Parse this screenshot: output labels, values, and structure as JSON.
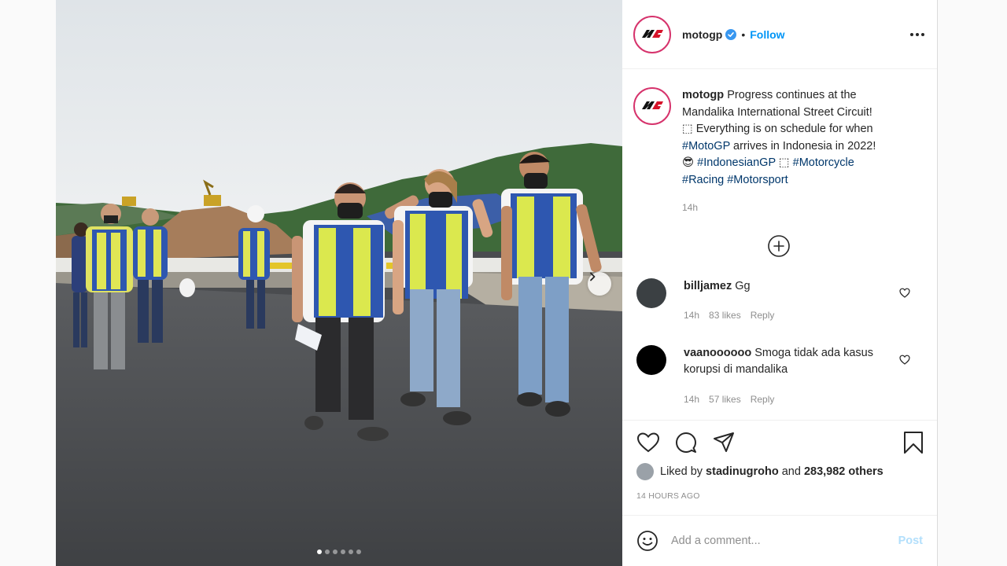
{
  "post": {
    "username": "motogp",
    "follow_label": "Follow",
    "separator": "•",
    "caption_lines": [
      [
        {
          "t": "Progress continues at the",
          "tag": false
        }
      ],
      [
        {
          "t": "Mandalika International Street Circuit!",
          "tag": false
        }
      ],
      [
        {
          "t": "⬚ Everything is on schedule for when",
          "tag": false
        }
      ],
      [
        {
          "t": "#MotoGP",
          "tag": true
        },
        {
          "t": " arrives in Indonesia in 2022!",
          "tag": false
        }
      ],
      [
        {
          "t": "😎 ",
          "tag": false
        },
        {
          "t": "#IndonesianGP",
          "tag": true
        },
        {
          "t": " ⬚ ",
          "tag": false
        },
        {
          "t": "#Motorcycle",
          "tag": true
        }
      ],
      [
        {
          "t": "#Racing",
          "tag": true
        },
        {
          "t": " ",
          "tag": false
        },
        {
          "t": "#Motorsport",
          "tag": true
        }
      ]
    ],
    "caption_time": "14h",
    "photo_count": 6,
    "active_photo": 0
  },
  "comments": [
    {
      "user": "billjamez",
      "text": "Gg",
      "time": "14h",
      "likes": "83 likes",
      "reply": "Reply",
      "avatar_color": "#3b4043"
    },
    {
      "user": "vaanoooooo",
      "text": "Smoga tidak ada kasus korupsi di mandalika",
      "time": "14h",
      "likes": "57 likes",
      "reply": "Reply",
      "avatar_color": "#000000"
    }
  ],
  "likes": {
    "prefix": "Liked by",
    "user": "stadinugroho",
    "joiner": "and",
    "count": "283,982 others"
  },
  "timestamp": "14 HOURS AGO",
  "add_comment": {
    "placeholder": "Add a comment...",
    "post_label": "Post"
  },
  "colors": {
    "link": "#0095f6",
    "hashtag": "#00376b",
    "muted": "#8e8e8e",
    "post_disabled": "#b2dffc"
  },
  "icons": [
    "motogp-logo-icon",
    "verified-icon",
    "more-icon",
    "load-more-icon",
    "heart-icon",
    "comment-icon",
    "share-icon",
    "bookmark-icon",
    "emoji-icon",
    "chevron-right-icon"
  ]
}
